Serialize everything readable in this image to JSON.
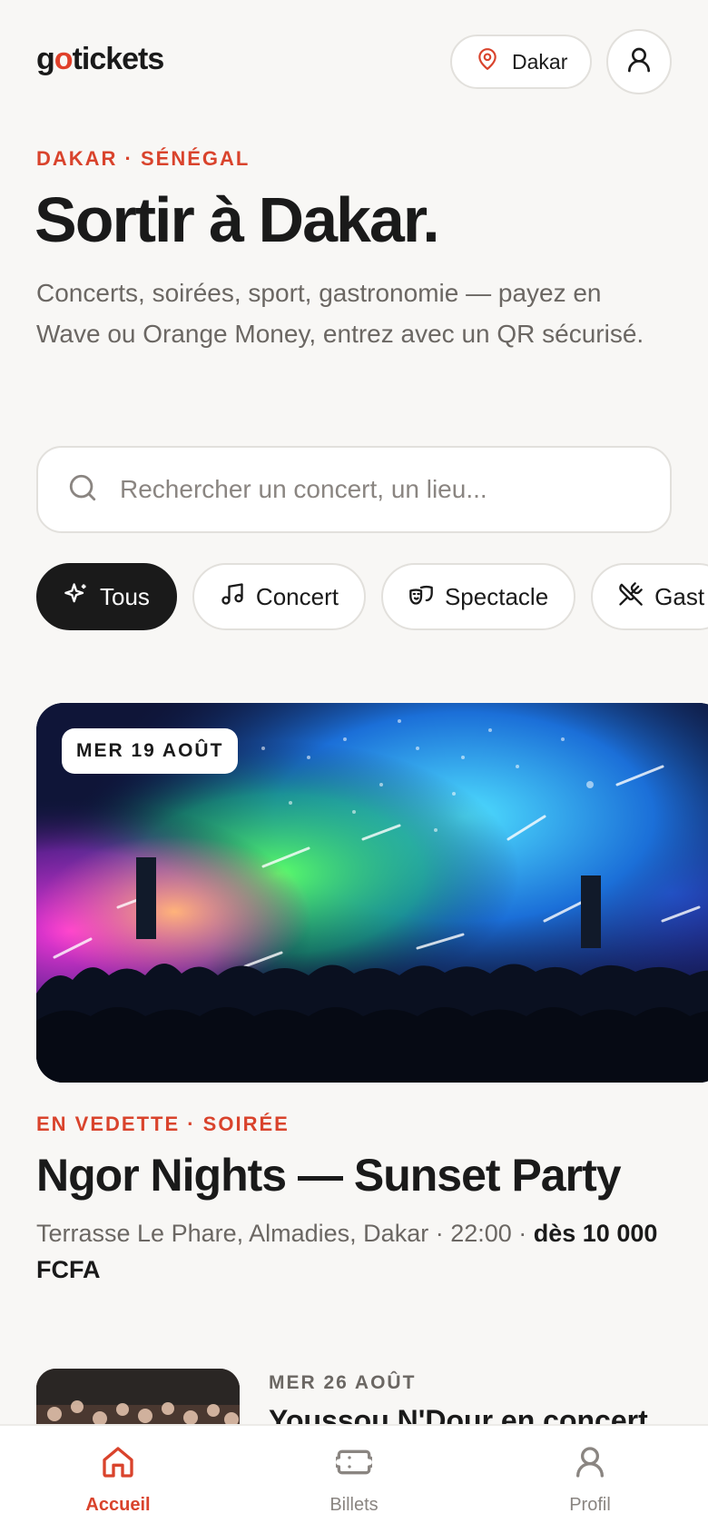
{
  "header": {
    "logo_prefix": "g",
    "logo_o": "o",
    "logo_suffix": "tickets",
    "location_label": "Dakar",
    "location_icon": "map-pin-icon",
    "profile_icon": "user-icon"
  },
  "hero_text": {
    "eyebrow": "DAKAR · SÉNÉGAL",
    "title": "Sortir à Dakar.",
    "subtitle": "Concerts, soirées, sport, gastronomie — payez en Wave ou Orange Money, entrez avec un QR sécurisé."
  },
  "search": {
    "placeholder": "Rechercher un concert, un lieu...",
    "value": "",
    "icon": "search-icon"
  },
  "categories": [
    {
      "label": "Tous",
      "icon": "sparkles-icon",
      "active": true
    },
    {
      "label": "Concert",
      "icon": "music-note-icon",
      "active": false
    },
    {
      "label": "Spectacle",
      "icon": "theater-masks-icon",
      "active": false
    },
    {
      "label": "Gast",
      "icon": "utensils-crossed-icon",
      "active": false
    }
  ],
  "featured": {
    "date": "MER 19 AOÛT",
    "eyebrow": "EN VEDETTE · SOIRÉE",
    "title": "Ngor Nights — Sunset Party",
    "venue_time": "Terrasse Le Phare, Almadies, Dakar · 22:00 · ",
    "price": "dès 10 000 FCFA"
  },
  "next_event": {
    "date": "MER 26 AOÛT",
    "title": "Youssou N'Dour en concert"
  },
  "tabbar": [
    {
      "label": "Accueil",
      "icon": "home-icon",
      "active": true
    },
    {
      "label": "Billets",
      "icon": "ticket-icon",
      "active": false
    },
    {
      "label": "Profil",
      "icon": "user-icon",
      "active": false
    }
  ],
  "colors": {
    "accent": "#d9432c",
    "background": "#f8f7f5",
    "text": "#1a1a1a",
    "muted": "#6b6763"
  }
}
